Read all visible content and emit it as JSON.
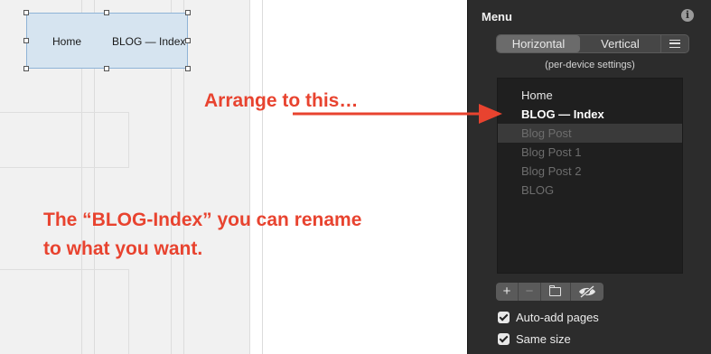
{
  "canvas": {
    "menu_widget": {
      "items": [
        "Home",
        "BLOG — Index"
      ]
    },
    "annotation_arrow_text": "Arrange to this…",
    "annotation_note_line1": "The “BLOG-Index” you can rename",
    "annotation_note_line2": "to what you want.",
    "annotation_color": "#e8432f"
  },
  "panel": {
    "title": "Menu",
    "info_icon": "info-icon",
    "orientation": {
      "options": [
        "Horizontal",
        "Vertical"
      ],
      "selected": "Horizontal",
      "more_icon": "hamburger-icon"
    },
    "note": "(per-device settings)",
    "menu_items": [
      {
        "label": "Home",
        "state": "normal"
      },
      {
        "label": "BLOG — Index",
        "state": "bold"
      },
      {
        "label": "Blog Post",
        "state": "dim-selected"
      },
      {
        "label": "Blog Post 1",
        "state": "dim"
      },
      {
        "label": "Blog Post 2",
        "state": "dim"
      },
      {
        "label": "BLOG",
        "state": "dim"
      }
    ],
    "toolbar": {
      "add": "+",
      "remove": "−",
      "folder_icon": "folder-icon",
      "visibility_icon": "eye-slash-icon"
    },
    "auto_add_pages": {
      "label": "Auto-add pages",
      "checked": true
    },
    "same_size": {
      "label": "Same size",
      "checked": true
    }
  }
}
